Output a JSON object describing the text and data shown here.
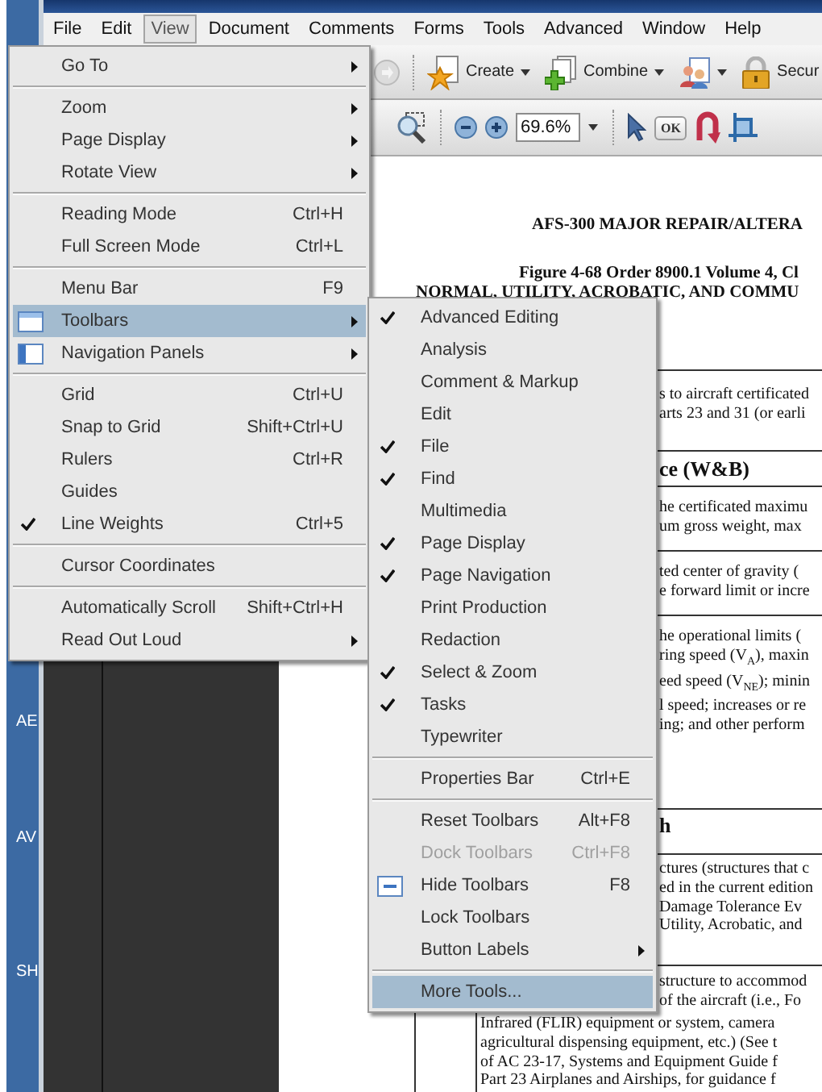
{
  "menu_bar": [
    {
      "label": "File",
      "selected": false
    },
    {
      "label": "Edit",
      "selected": false
    },
    {
      "label": "View",
      "selected": true
    },
    {
      "label": "Document",
      "selected": false
    },
    {
      "label": "Comments",
      "selected": false
    },
    {
      "label": "Forms",
      "selected": false
    },
    {
      "label": "Tools",
      "selected": false
    },
    {
      "label": "Advanced",
      "selected": false
    },
    {
      "label": "Window",
      "selected": false
    },
    {
      "label": "Help",
      "selected": false
    }
  ],
  "toolbar_top": {
    "create_label": "Create",
    "combine_label": "Combine",
    "secure_label": "Secur"
  },
  "toolbar_bottom": {
    "zoom_value": "69.6%",
    "ok_label": "OK"
  },
  "side_tabs": [
    "AE",
    "AV",
    "SH"
  ],
  "view_menu": {
    "sections": [
      {
        "items": [
          {
            "label": "Go To",
            "checked": false,
            "submenu": true,
            "selected": false,
            "disabled": false
          }
        ]
      },
      {
        "items": [
          {
            "label": "Zoom",
            "checked": false,
            "submenu": true,
            "selected": false,
            "disabled": false
          },
          {
            "label": "Page Display",
            "checked": false,
            "submenu": true,
            "selected": false,
            "disabled": false
          },
          {
            "label": "Rotate View",
            "checked": false,
            "submenu": true,
            "selected": false,
            "disabled": false
          }
        ]
      },
      {
        "items": [
          {
            "label": "Reading Mode",
            "shortcut": "Ctrl+H",
            "checked": false,
            "submenu": false,
            "selected": false,
            "disabled": false
          },
          {
            "label": "Full Screen Mode",
            "shortcut": "Ctrl+L",
            "checked": false,
            "submenu": false,
            "selected": false,
            "disabled": false
          }
        ]
      },
      {
        "items": [
          {
            "label": "Menu Bar",
            "shortcut": "F9",
            "checked": false,
            "submenu": false,
            "selected": false,
            "disabled": false
          },
          {
            "label": "Toolbars",
            "checked": false,
            "submenu": true,
            "selected": true,
            "disabled": false
          },
          {
            "label": "Navigation Panels",
            "checked": false,
            "submenu": true,
            "selected": false,
            "disabled": false
          }
        ]
      },
      {
        "items": [
          {
            "label": "Grid",
            "shortcut": "Ctrl+U",
            "checked": false,
            "submenu": false,
            "selected": false,
            "disabled": false
          },
          {
            "label": "Snap to Grid",
            "shortcut": "Shift+Ctrl+U",
            "checked": false,
            "submenu": false,
            "selected": false,
            "disabled": false
          },
          {
            "label": "Rulers",
            "shortcut": "Ctrl+R",
            "checked": false,
            "submenu": false,
            "selected": false,
            "disabled": false
          },
          {
            "label": "Guides",
            "checked": false,
            "submenu": false,
            "selected": false,
            "disabled": false
          },
          {
            "label": "Line Weights",
            "shortcut": "Ctrl+5",
            "checked": true,
            "submenu": false,
            "selected": false,
            "disabled": false
          }
        ]
      },
      {
        "items": [
          {
            "label": "Cursor Coordinates",
            "checked": false,
            "submenu": false,
            "selected": false,
            "disabled": false
          }
        ]
      },
      {
        "items": [
          {
            "label": "Automatically Scroll",
            "shortcut": "Shift+Ctrl+H",
            "checked": false,
            "submenu": false,
            "selected": false,
            "disabled": false
          },
          {
            "label": "Read Out Loud",
            "checked": false,
            "submenu": true,
            "selected": false,
            "disabled": false
          }
        ]
      }
    ]
  },
  "toolbars_menu": {
    "sections": [
      {
        "items": [
          {
            "label": "Advanced Editing",
            "checked": true,
            "submenu": false,
            "selected": false,
            "disabled": false
          },
          {
            "label": "Analysis",
            "checked": false,
            "submenu": false,
            "selected": false,
            "disabled": false
          },
          {
            "label": "Comment & Markup",
            "checked": false,
            "submenu": false,
            "selected": false,
            "disabled": false
          },
          {
            "label": "Edit",
            "checked": false,
            "submenu": false,
            "selected": false,
            "disabled": false
          },
          {
            "label": "File",
            "checked": true,
            "submenu": false,
            "selected": false,
            "disabled": false
          },
          {
            "label": "Find",
            "checked": true,
            "submenu": false,
            "selected": false,
            "disabled": false
          },
          {
            "label": "Multimedia",
            "checked": false,
            "submenu": false,
            "selected": false,
            "disabled": false
          },
          {
            "label": "Page Display",
            "checked": true,
            "submenu": false,
            "selected": false,
            "disabled": false
          },
          {
            "label": "Page Navigation",
            "checked": true,
            "submenu": false,
            "selected": false,
            "disabled": false
          },
          {
            "label": "Print Production",
            "checked": false,
            "submenu": false,
            "selected": false,
            "disabled": false
          },
          {
            "label": "Redaction",
            "checked": false,
            "submenu": false,
            "selected": false,
            "disabled": false
          },
          {
            "label": "Select & Zoom",
            "checked": true,
            "submenu": false,
            "selected": false,
            "disabled": false
          },
          {
            "label": "Tasks",
            "checked": true,
            "submenu": false,
            "selected": false,
            "disabled": false
          },
          {
            "label": "Typewriter",
            "checked": false,
            "submenu": false,
            "selected": false,
            "disabled": false
          }
        ]
      },
      {
        "items": [
          {
            "label": "Properties Bar",
            "shortcut": "Ctrl+E",
            "checked": false,
            "submenu": false,
            "selected": false,
            "disabled": false
          }
        ]
      },
      {
        "items": [
          {
            "label": "Reset Toolbars",
            "shortcut": "Alt+F8",
            "checked": false,
            "submenu": false,
            "selected": false,
            "disabled": false
          },
          {
            "label": "Dock Toolbars",
            "shortcut": "Ctrl+F8",
            "checked": false,
            "submenu": false,
            "selected": false,
            "disabled": true
          },
          {
            "label": "Hide Toolbars",
            "shortcut": "F8",
            "checked": false,
            "submenu": false,
            "selected": false,
            "disabled": false
          },
          {
            "label": "Lock Toolbars",
            "checked": false,
            "submenu": false,
            "selected": false,
            "disabled": false
          },
          {
            "label": "Button Labels",
            "checked": false,
            "submenu": true,
            "selected": false,
            "disabled": false
          }
        ]
      },
      {
        "items": [
          {
            "label": "More Tools...",
            "checked": false,
            "submenu": false,
            "selected": true,
            "disabled": false
          }
        ]
      }
    ]
  },
  "document": {
    "title": "AFS-300 MAJOR REPAIR/ALTERA",
    "figure": "Figure 4-68 Order 8900.1 Volume 4, Cl",
    "subtitle": "NORMAL, UTILITY, ACROBATIC, AND COMMU",
    "rows": [
      {
        "kind": "cell",
        "lines": [
          "s to aircraft certificated",
          "arts 23 and 31 (or earli"
        ]
      },
      {
        "kind": "heading",
        "lines": [
          "ce (W&B)"
        ]
      },
      {
        "kind": "cell",
        "lines": [
          "he certificated maximu",
          "um gross weight, max"
        ]
      },
      {
        "kind": "cell",
        "lines": [
          "ted center of gravity (",
          "e forward limit or incre"
        ]
      },
      {
        "kind": "cell",
        "lines": [
          "he operational limits (",
          "ring speed (V$_{A}$), maxin",
          "eed speed (V$_{NE}$); minin",
          "l speed; increases or re",
          "ing; and other perform"
        ]
      },
      {
        "kind": "heading",
        "lines": [
          "h"
        ]
      },
      {
        "kind": "cell",
        "lines": [
          "ctures (structures that c",
          "ed in the current edition",
          "Damage Tolerance Ev",
          "Utility, Acrobatic, and"
        ]
      },
      {
        "kind": "cell",
        "lines": [
          "structure to accommod",
          "of the aircraft (i.e., Fo"
        ],
        "more_lines": [
          "Infrared (FLIR) equipment or system, camera",
          "agricultural dispensing equipment, etc.) (See t",
          "of AC 23-17, Systems and Equipment Guide f",
          "Part 23 Airplanes and Airships, for guidance f"
        ]
      }
    ]
  }
}
